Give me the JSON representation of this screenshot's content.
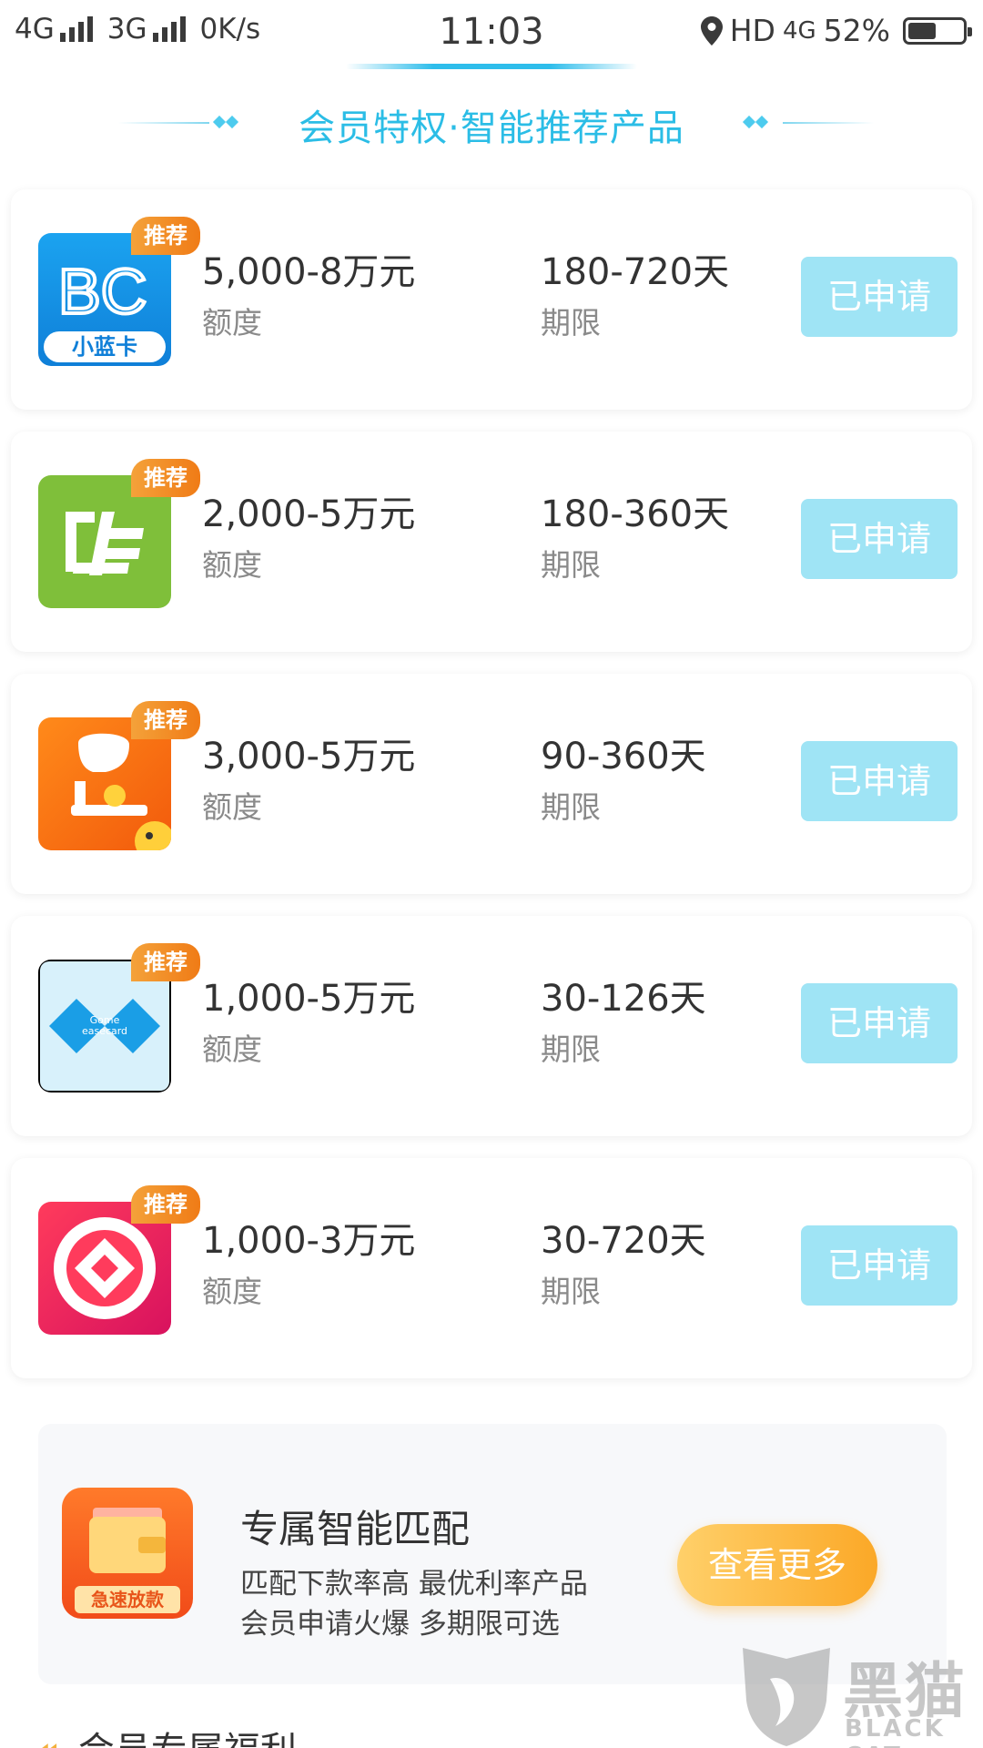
{
  "status_bar": {
    "net1": "4G",
    "net2": "3G",
    "speed": "0K/s",
    "time": "11:03",
    "hd": "HD",
    "net3": "4G",
    "battery": "52%",
    "battery_level": 0.52
  },
  "section": {
    "title": "会员特权·智能推荐产品"
  },
  "products": [
    {
      "logo_icon": "xiaolanka-bc-logo",
      "logo_text_main": "BC",
      "logo_text_sub": "小蓝卡",
      "badge": "推荐",
      "amount": "5,000-8万元",
      "amount_label": "额度",
      "term": "180-720天",
      "term_label": "期限",
      "button": "已申请"
    },
    {
      "logo_icon": "green-card-logo",
      "badge": "推荐",
      "amount": "2,000-5万元",
      "amount_label": "额度",
      "term": "180-360天",
      "term_label": "期限",
      "button": "已申请"
    },
    {
      "logo_icon": "orange-mascot-logo",
      "badge": "推荐",
      "amount": "3,000-5万元",
      "amount_label": "额度",
      "term": "90-360天",
      "term_label": "期限",
      "button": "已申请"
    },
    {
      "logo_icon": "gome-easecard-logo",
      "logo_text_main": "Gome",
      "logo_text_sub": "easecard",
      "badge": "推荐",
      "amount": "1,000-5万元",
      "amount_label": "额度",
      "term": "30-126天",
      "term_label": "期限",
      "button": "已申请"
    },
    {
      "logo_icon": "red-coin-logo",
      "badge": "推荐",
      "amount": "1,000-3万元",
      "amount_label": "额度",
      "term": "30-720天",
      "term_label": "期限",
      "button": "已申请"
    }
  ],
  "smart_match": {
    "logo_label": "急速放款",
    "title": "专属智能匹配",
    "desc1": "匹配下款率高 最优利率产品",
    "desc2": "会员申请火爆 多期限可选",
    "button": "查看更多"
  },
  "bottom": {
    "partial_title": "会员专属福利"
  },
  "watermark": {
    "text": "黑猫",
    "sub": "BLACK CAT"
  },
  "colors": {
    "accent": "#2bbde6",
    "applied_button": "#9fe4f5",
    "badge": "#f07b16",
    "more_button": "#fba827"
  }
}
